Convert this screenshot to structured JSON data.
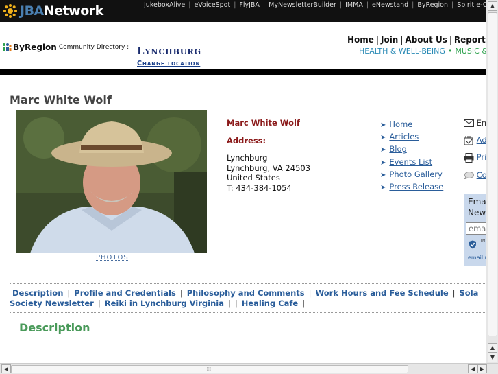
{
  "brand": {
    "jba": "JBA",
    "network": "Network"
  },
  "top_links": [
    "JukeboxAlive",
    "eVoiceSpot",
    "FlyJBA",
    "MyNewsletterBuilder",
    "IMMA",
    "eNewstand",
    "ByRegion",
    "Spirit e-G"
  ],
  "byregion": {
    "name": "ByRegion",
    "subtitle": "Community Directory :"
  },
  "location": {
    "city": "Lynchburg",
    "change": "Change location"
  },
  "nav": {
    "home": "Home",
    "join": "Join",
    "about": "About Us",
    "report": "Report A"
  },
  "categories": {
    "health": "HEALTH & WELL-BEING",
    "dot": "•",
    "music": "MUSIC &"
  },
  "profile": {
    "title": "Marc White Wolf",
    "name": "Marc White Wolf",
    "address_label": "Address:",
    "address_lines": [
      "Lynchburg",
      "Lynchburg, VA 24503",
      "United States",
      "T: 434-384-1054"
    ],
    "photos_link": "PHOTOS"
  },
  "menu": [
    "Home",
    "Articles",
    "Blog",
    "Events List",
    "Photo Gallery",
    "Press Release"
  ],
  "actions": {
    "email": "Em",
    "add": "Ad",
    "print": "Pri",
    "contact": "Con"
  },
  "signup": {
    "title_1": "Emai",
    "title_2": "News",
    "placeholder": "emai",
    "footer": "email n",
    "tm": "TM"
  },
  "tabs": [
    "Description",
    "Profile and Credentials",
    "Philosophy and Comments",
    "Work Hours and Fee Schedule",
    "Sola",
    "Society Newsletter",
    "Reiki in Lynchburg Virginia",
    "",
    "Healing Cafe"
  ],
  "tab_separator": "|",
  "section": {
    "description_title": "Description"
  },
  "colors": {
    "topbar": "#111111",
    "accent_blue": "#2a5d9a",
    "accent_red": "#8b1a1a",
    "accent_green": "#4a9a5a"
  }
}
